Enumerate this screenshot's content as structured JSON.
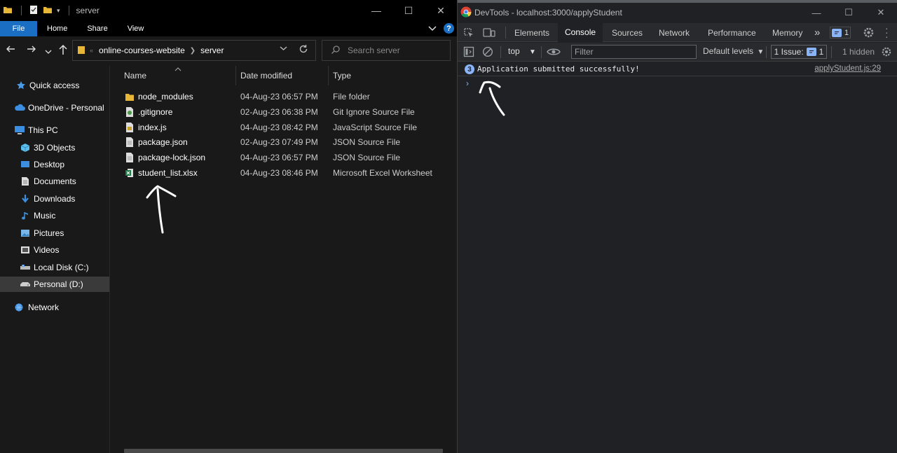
{
  "explorer": {
    "title": "server",
    "window_controls": {
      "minimize": "—",
      "maximize": "☐",
      "close": "✕"
    },
    "ribbon_tabs": [
      "File",
      "Home",
      "Share",
      "View"
    ],
    "help_label": "?",
    "breadcrumb": [
      "online-courses-website",
      "server"
    ],
    "search_placeholder": "Search server",
    "sidebar": {
      "items": [
        {
          "label": "Quick access",
          "icon": "star-icon"
        },
        {
          "label": "OneDrive - Personal",
          "icon": "cloud-icon"
        },
        {
          "label": "This PC",
          "icon": "computer-icon"
        },
        {
          "label": "3D Objects",
          "icon": "cube-icon"
        },
        {
          "label": "Desktop",
          "icon": "desktop-icon"
        },
        {
          "label": "Documents",
          "icon": "documents-icon"
        },
        {
          "label": "Downloads",
          "icon": "download-icon"
        },
        {
          "label": "Music",
          "icon": "music-icon"
        },
        {
          "label": "Pictures",
          "icon": "pictures-icon"
        },
        {
          "label": "Videos",
          "icon": "videos-icon"
        },
        {
          "label": "Local Disk (C:)",
          "icon": "drive-icon"
        },
        {
          "label": "Personal (D:)",
          "icon": "drive-icon"
        },
        {
          "label": "Network",
          "icon": "network-icon"
        }
      ]
    },
    "columns": {
      "name": "Name",
      "date": "Date modified",
      "type": "Type"
    },
    "files": [
      {
        "name": "node_modules",
        "date": "04-Aug-23 06:57 PM",
        "type": "File folder",
        "icon": "folder-icon"
      },
      {
        "name": ".gitignore",
        "date": "02-Aug-23 06:38 PM",
        "type": "Git Ignore Source File",
        "icon": "gitignore-file-icon"
      },
      {
        "name": "index.js",
        "date": "04-Aug-23 08:42 PM",
        "type": "JavaScript Source File",
        "icon": "js-file-icon"
      },
      {
        "name": "package.json",
        "date": "02-Aug-23 07:49 PM",
        "type": "JSON Source File",
        "icon": "json-file-icon"
      },
      {
        "name": "package-lock.json",
        "date": "04-Aug-23 06:57 PM",
        "type": "JSON Source File",
        "icon": "json-file-icon"
      },
      {
        "name": "student_list.xlsx",
        "date": "04-Aug-23 08:46 PM",
        "type": "Microsoft Excel Worksheet",
        "icon": "excel-file-icon"
      }
    ]
  },
  "devtools": {
    "title": "DevTools - localhost:3000/applyStudent",
    "tabs": [
      "Elements",
      "Console",
      "Sources",
      "Network",
      "Performance",
      "Memory"
    ],
    "more_tabs": "»",
    "tab_issue_count": "1",
    "context": "top",
    "filter_placeholder": "Filter",
    "levels": "Default levels",
    "issues_label": "1 Issue:",
    "issues_count": "1",
    "hidden": "1 hidden",
    "console": {
      "count": "3",
      "message": "Application submitted successfully!",
      "source": "applyStudent.js:29",
      "prompt": "›"
    }
  },
  "colors": {
    "accent": "#1a6fc4",
    "devtools_blue": "#8ab4f8",
    "folder_yellow": "#e8b738"
  }
}
